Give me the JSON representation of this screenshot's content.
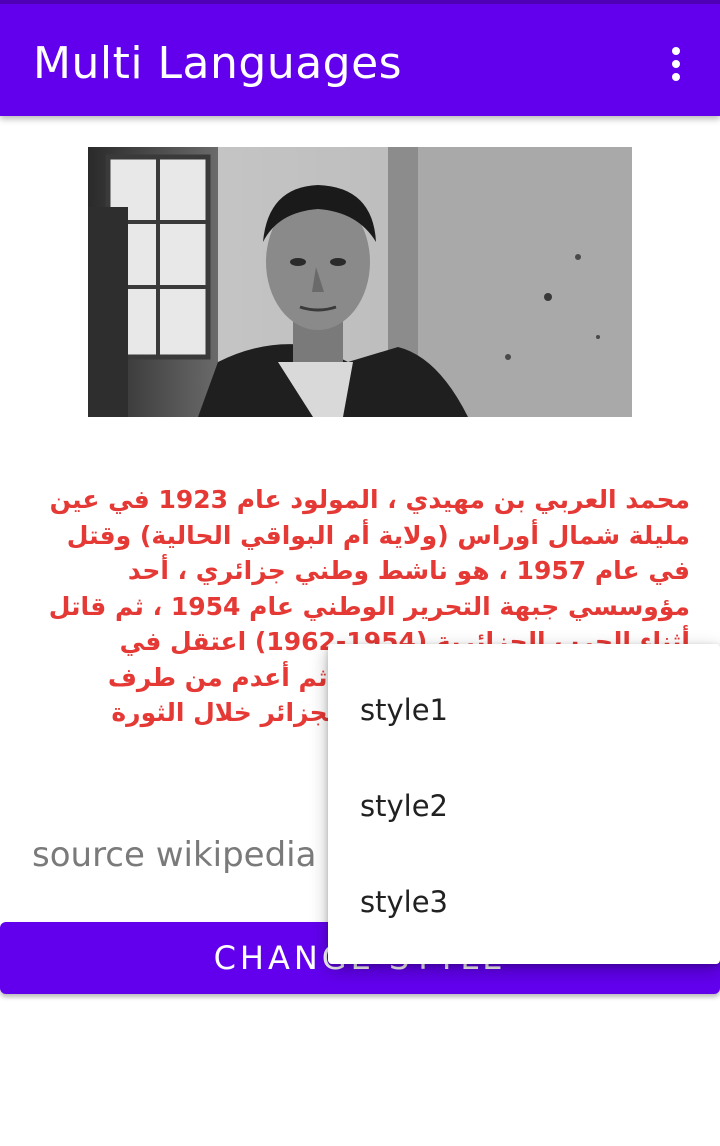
{
  "app_bar": {
    "title": "Multi Languages",
    "overflow_icon": "more-vert-icon",
    "color": "#6200ee"
  },
  "photo": {
    "description_icon": "portrait-photo"
  },
  "content": {
    "arabic_text": "محمد العربي بن مهيدي ، المولود عام 1923 في عين مليلة شمال أوراس (ولاية أم البواقي الحالية) وقتل في عام 1957 ، هو ناشط وطني جزائري ، أحد مؤوسسي جبهة التحرير الوطني عام 1954 ، ثم قاتل أثناء الحرب الجزائرية (1954-1962) اعتقل في فبراير 1957 وتعرض للتعذيب ثم أعدم من طرف الجيش الفرنسي في معركة الجزائر خلال الثورة الجزائرية ونسب اسمه إلى",
    "text_color": "#e53935",
    "source": "source wikipedia"
  },
  "change_button": {
    "label": "CHANGE STYLE"
  },
  "menu": {
    "items": [
      {
        "label": "style1"
      },
      {
        "label": "style2"
      },
      {
        "label": "style3"
      }
    ]
  }
}
